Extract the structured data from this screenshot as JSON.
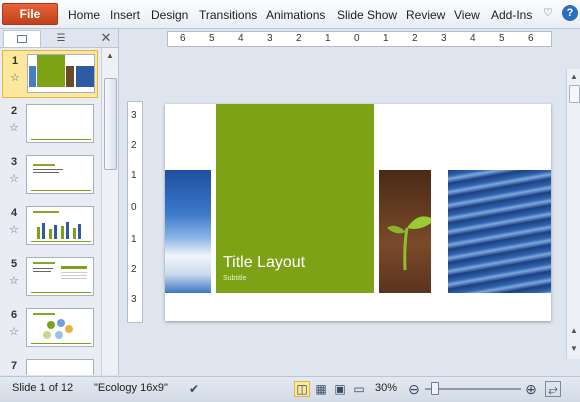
{
  "ribbon": {
    "file_label": "File",
    "tabs": [
      "Home",
      "Insert",
      "Design",
      "Transitions",
      "Animations",
      "Slide Show",
      "Review",
      "View",
      "Add-Ins"
    ],
    "help_label": "?"
  },
  "thumbnails": {
    "numbers": [
      "1",
      "2",
      "3",
      "4",
      "5",
      "6",
      "7"
    ],
    "selected": "1",
    "star": "☆"
  },
  "rulers": {
    "horizontal": [
      "6",
      "5",
      "4",
      "3",
      "2",
      "1",
      "0",
      "1",
      "2",
      "3",
      "4",
      "5",
      "6"
    ],
    "vertical": [
      "3",
      "2",
      "1",
      "0",
      "1",
      "2",
      "3"
    ]
  },
  "slide": {
    "title": "Title Layout",
    "subtitle": "Subtitle"
  },
  "status": {
    "slide_info": "Slide 1 of 12",
    "theme": "\"Ecology 16x9\"",
    "zoom": "30%",
    "zoom_fraction": 0.3
  },
  "colors": {
    "accent_green": "#7ea215",
    "file_orange": "#d4522a",
    "selected_bg": "#fbe89c"
  },
  "icons": [
    "down-caret",
    "help",
    "slides-tab",
    "outline-tab",
    "close",
    "star",
    "spell-check",
    "normal-view",
    "slide-sorter",
    "reading-view",
    "slideshow",
    "zoom-out",
    "zoom-in",
    "fit-window",
    "next-slide"
  ]
}
